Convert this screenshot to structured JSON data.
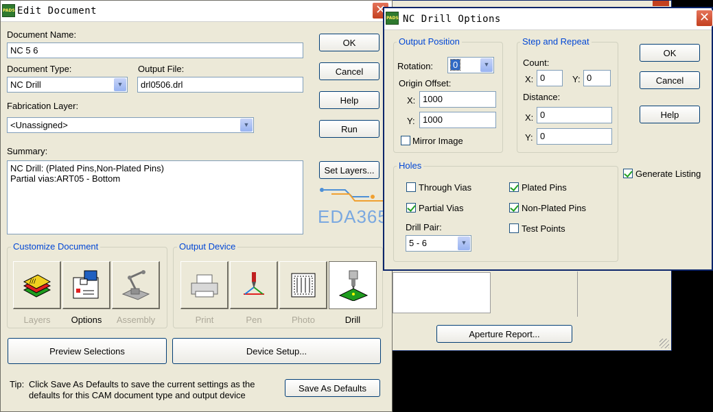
{
  "edit_document": {
    "title": "Edit Document",
    "doc_name_label": "Document Name:",
    "doc_name_value": "NC 5 6",
    "doc_type_label": "Document Type:",
    "doc_type_value": "NC Drill",
    "output_file_label": "Output File:",
    "output_file_value": "drl0506.drl",
    "fab_layer_label": "Fabrication Layer:",
    "fab_layer_value": "<Unassigned>",
    "summary_label": "Summary:",
    "summary_line1": "NC Drill: (Plated Pins,Non-Plated Pins)",
    "summary_line2": "Partial vias:ART05 - Bottom",
    "buttons": {
      "ok": "OK",
      "cancel": "Cancel",
      "help": "Help",
      "run": "Run",
      "set_layers": "Set Layers...",
      "preview": "Preview Selections",
      "device_setup": "Device Setup...",
      "save_defaults": "Save As Defaults"
    },
    "customize_title": "Customize Document",
    "customize_tiles": [
      {
        "label": "Layers",
        "enabled": false
      },
      {
        "label": "Options",
        "enabled": true
      },
      {
        "label": "Assembly",
        "enabled": false
      }
    ],
    "output_device_title": "Output Device",
    "device_tiles": [
      {
        "label": "Print",
        "enabled": false
      },
      {
        "label": "Pen",
        "enabled": false
      },
      {
        "label": "Photo",
        "enabled": false
      },
      {
        "label": "Drill",
        "enabled": true,
        "selected": true
      }
    ],
    "tip_label": "Tip:",
    "tip_line1": "Click Save As Defaults to save the current settings as the",
    "tip_line2": "defaults for this CAM document type and output device"
  },
  "watermark": {
    "text": "EDA365"
  },
  "background_window": {
    "aperture_button": "Aperture Report..."
  },
  "nc_drill": {
    "title": "NC Drill Options",
    "output_position": {
      "title": "Output Position",
      "rotation_label": "Rotation:",
      "rotation_value": "0",
      "origin_offset_label": "Origin Offset:",
      "x_label": "X:",
      "x_value": "1000",
      "y_label": "Y:",
      "y_value": "1000",
      "mirror_label": "Mirror Image",
      "mirror_checked": false
    },
    "step_repeat": {
      "title": "Step and Repeat",
      "count_label": "Count:",
      "count_x_label": "X:",
      "count_x_value": "0",
      "count_y_label": "Y:",
      "count_y_value": "0",
      "distance_label": "Distance:",
      "dist_x_label": "X:",
      "dist_x_value": "0",
      "dist_y_label": "Y:",
      "dist_y_value": "0"
    },
    "holes": {
      "title": "Holes",
      "through_vias": "Through Vias",
      "through_vias_checked": false,
      "partial_vias": "Partial Vias",
      "partial_vias_checked": true,
      "plated_pins": "Plated Pins",
      "plated_pins_checked": true,
      "non_plated_pins": "Non-Plated Pins",
      "non_plated_pins_checked": true,
      "test_points": "Test Points",
      "test_points_checked": false,
      "drill_pair_label": "Drill Pair:",
      "drill_pair_value": "5 - 6"
    },
    "generate_listing": "Generate Listing",
    "generate_listing_checked": true,
    "buttons": {
      "ok": "OK",
      "cancel": "Cancel",
      "help": "Help"
    }
  },
  "colors": {
    "dialog_bg": "#ece9d8",
    "group_title": "#0046d5",
    "title_bar_active": "#0a246a",
    "close_red": "#c3401f",
    "watermark_blue": "#4c8fd6",
    "watermark_orange": "#f0a030"
  }
}
